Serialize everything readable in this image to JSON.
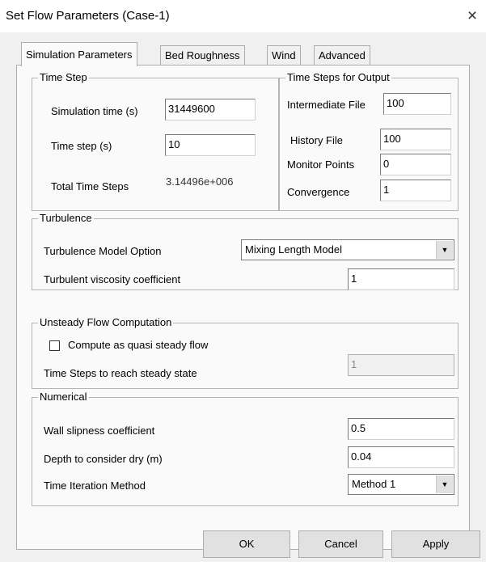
{
  "window": {
    "title": "Set Flow Parameters (Case-1)",
    "close_glyph": "×"
  },
  "tabs": [
    {
      "label": "Simulation Parameters",
      "active": true
    },
    {
      "label": "Bed Roughness",
      "active": false
    },
    {
      "label": "Wind",
      "active": false
    },
    {
      "label": "Advanced",
      "active": false
    }
  ],
  "time_step": {
    "group_label": "Time Step",
    "simulation_time_label": "Simulation time (s)",
    "simulation_time_value": "31449600",
    "time_step_label": "Time step (s)",
    "time_step_value": "10",
    "total_time_steps_label": "Total Time Steps",
    "total_time_steps_value": "3.14496e+006"
  },
  "output": {
    "group_label": "Time Steps for Output",
    "intermediate_label": "Intermediate File",
    "intermediate_value": "100",
    "history_label": "History File",
    "history_value": "100",
    "monitor_label": "Monitor Points",
    "monitor_value": "0",
    "convergence_label": "Convergence",
    "convergence_value": "1"
  },
  "turbulence": {
    "group_label": "Turbulence",
    "model_label": "Turbulence Model Option",
    "model_value": "Mixing Length Model",
    "viscosity_label": "Turbulent viscosity coefficient",
    "viscosity_value": "1"
  },
  "unsteady": {
    "group_label": "Unsteady Flow Computation",
    "quasi_label": "Compute as quasi steady flow",
    "quasi_checked": false,
    "steps_label": "Time Steps to reach steady state",
    "steps_value": "1"
  },
  "numerical": {
    "group_label": "Numerical",
    "wall_label": "Wall slipness coefficient",
    "wall_value": "0.5",
    "depth_label": "Depth to consider dry (m)",
    "depth_value": "0.04",
    "iteration_label": "Time Iteration Method",
    "iteration_value": "Method 1"
  },
  "buttons": {
    "ok": "OK",
    "cancel": "Cancel",
    "apply": "Apply"
  }
}
